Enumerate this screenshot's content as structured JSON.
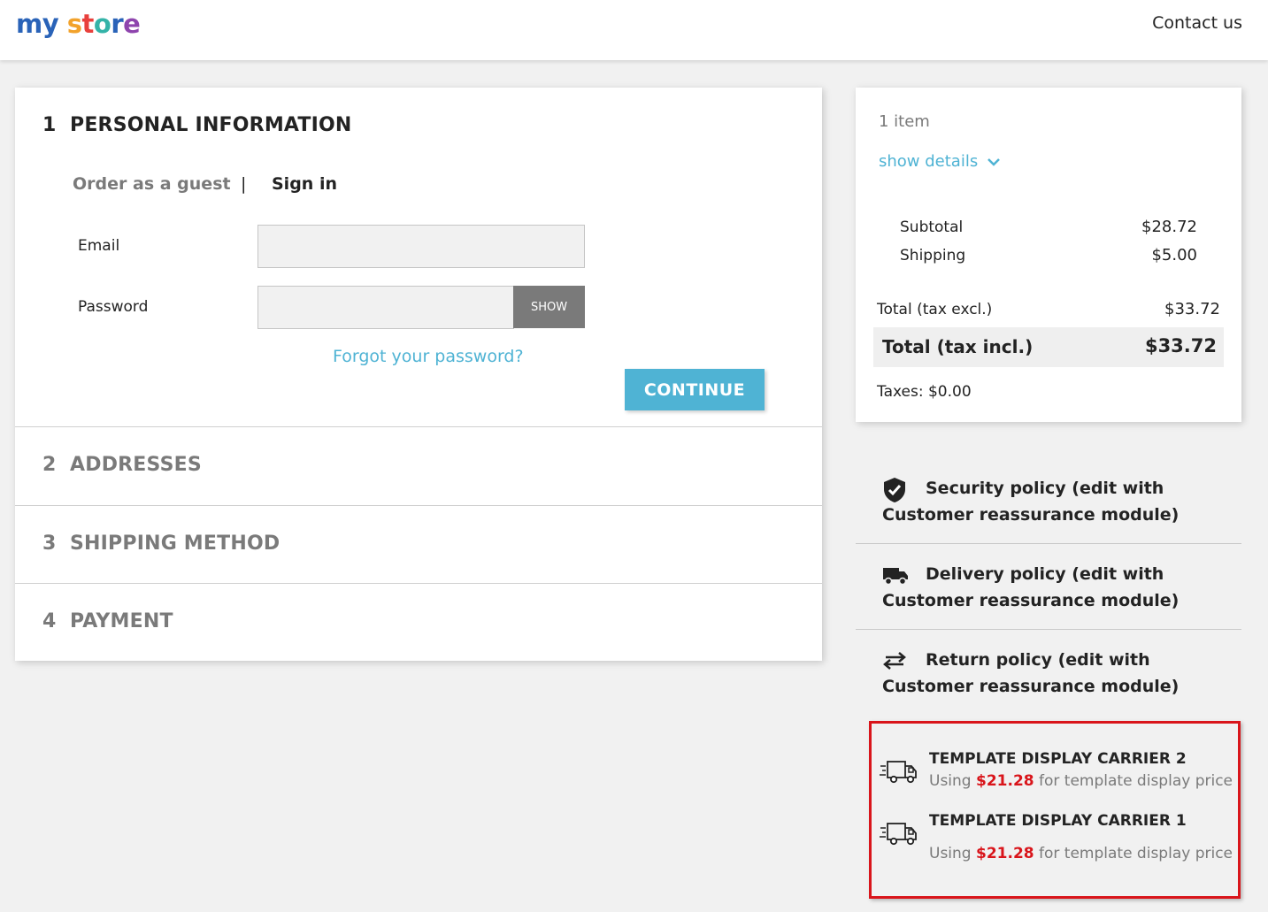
{
  "header": {
    "logo": {
      "part1": "my",
      "part2": "store"
    },
    "contact_label": "Contact us"
  },
  "steps": [
    {
      "number": "1",
      "title": "PERSONAL INFORMATION"
    },
    {
      "number": "2",
      "title": "ADDRESSES"
    },
    {
      "number": "3",
      "title": "SHIPPING METHOD"
    },
    {
      "number": "4",
      "title": "PAYMENT"
    }
  ],
  "personal": {
    "tab_guest": "Order as a guest",
    "tab_separator": "|",
    "tab_signin": "Sign in",
    "email_label": "Email",
    "email_value": "",
    "password_label": "Password",
    "password_value": "",
    "show_label": "SHOW",
    "forgot_label": "Forgot your password?",
    "continue_label": "CONTINUE"
  },
  "summary": {
    "items_count": "1 item",
    "show_details": "show details",
    "subtotal_label": "Subtotal",
    "subtotal_value": "$28.72",
    "shipping_label": "Shipping",
    "shipping_value": "$5.00",
    "total_excl_label": "Total (tax excl.)",
    "total_excl_value": "$33.72",
    "total_incl_label": "Total (tax incl.)",
    "total_incl_value": "$33.72",
    "taxes": "Taxes: $0.00"
  },
  "policies": [
    {
      "icon": "shield-check-icon",
      "text": "Security policy (edit with Customer reassurance module)"
    },
    {
      "icon": "truck-icon",
      "text": "Delivery policy (edit with Customer reassurance module)"
    },
    {
      "icon": "swap-arrows-icon",
      "text": "Return policy (edit with Customer reassurance module)"
    }
  ],
  "carriers": [
    {
      "name": "TEMPLATE DISPLAY CARRIER 2",
      "desc_prefix": "Using ",
      "price": "$21.28",
      "desc_suffix": " for template display price"
    },
    {
      "name": "TEMPLATE DISPLAY CARRIER 1",
      "desc_prefix": "Using ",
      "price": "$21.28",
      "desc_suffix": " for template display price"
    }
  ],
  "colors": {
    "accent": "#4fb3d4",
    "highlight_border": "#d9151b",
    "price_red": "#d9151b"
  }
}
